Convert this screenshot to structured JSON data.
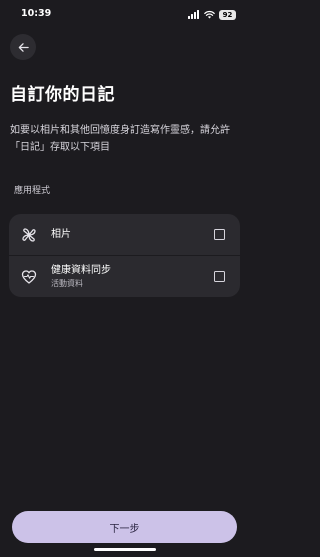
{
  "status_bar": {
    "time": "10:39",
    "battery": "92"
  },
  "header": {
    "back_icon": "arrow-left-icon",
    "title": "自訂你的日記"
  },
  "description": "如要以相片和其他回憶度身訂造寫作靈感，請允許「日記」存取以下項目",
  "section_label": "應用程式",
  "permissions": [
    {
      "icon": "pinwheel-icon",
      "label": "相片",
      "sublabel": "",
      "checked": false
    },
    {
      "icon": "heart-icon",
      "label": "健康資料同步",
      "sublabel": "活動資料",
      "checked": false
    }
  ],
  "next_button": "下一步",
  "colors": {
    "background": "#1c1b1f",
    "card": "#2b2a2f",
    "accent_button": "#ccc2e8"
  }
}
